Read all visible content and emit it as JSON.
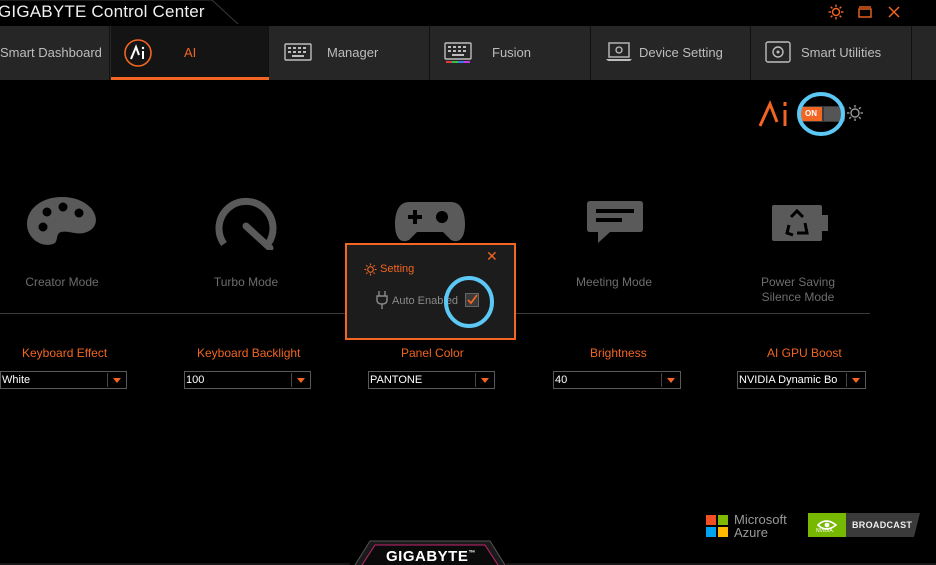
{
  "window": {
    "title": "GIGABYTE Control Center",
    "controls": [
      "gear-icon",
      "restore-icon",
      "close-icon"
    ]
  },
  "tabs": [
    {
      "label": "Smart Dashboard",
      "icon": "dashboard-icon",
      "active": false
    },
    {
      "label": "AI",
      "icon": "ai-logo-icon",
      "active": true
    },
    {
      "label": "Manager",
      "icon": "keyboard-icon",
      "active": false
    },
    {
      "label": "Fusion",
      "icon": "rgb-keyboard-icon",
      "active": false
    },
    {
      "label": "Device Setting",
      "icon": "laptop-icon",
      "active": false
    },
    {
      "label": "Smart Utilities",
      "icon": "utilities-icon",
      "active": false
    }
  ],
  "ai_switch": {
    "state": "ON"
  },
  "modes": [
    {
      "label": "Creator Mode",
      "icon": "palette-icon"
    },
    {
      "label": "Turbo Mode",
      "icon": "speedometer-icon"
    },
    {
      "label": "",
      "icon": "gamepad-icon"
    },
    {
      "label": "Meeting Mode",
      "icon": "chat-icon"
    },
    {
      "label": "Power Saving\nSilence Mode",
      "icon": "battery-recycle-icon"
    }
  ],
  "settings": [
    {
      "label": "Keyboard Effect",
      "value": "White"
    },
    {
      "label": "Keyboard Backlight",
      "value": "100"
    },
    {
      "label": "Panel Color",
      "value": "PANTONE"
    },
    {
      "label": "Brightness",
      "value": "40"
    },
    {
      "label": "AI GPU Boost",
      "value": "NVIDIA Dynamic Bo"
    }
  ],
  "popup": {
    "title": "Setting",
    "option_label": "Auto Enabled",
    "checked": true
  },
  "footer": {
    "microsoft_line1": "Microsoft",
    "microsoft_line2": "Azure",
    "nvidia_small": "NVIDIA.",
    "nvidia_label": "BROADCAST",
    "brand": "GIGABYTE",
    "trademark": "™"
  },
  "colors": {
    "accent": "#f26522",
    "annotation": "#5bc8f5",
    "background": "#000000",
    "tab_bar": "#262626"
  }
}
